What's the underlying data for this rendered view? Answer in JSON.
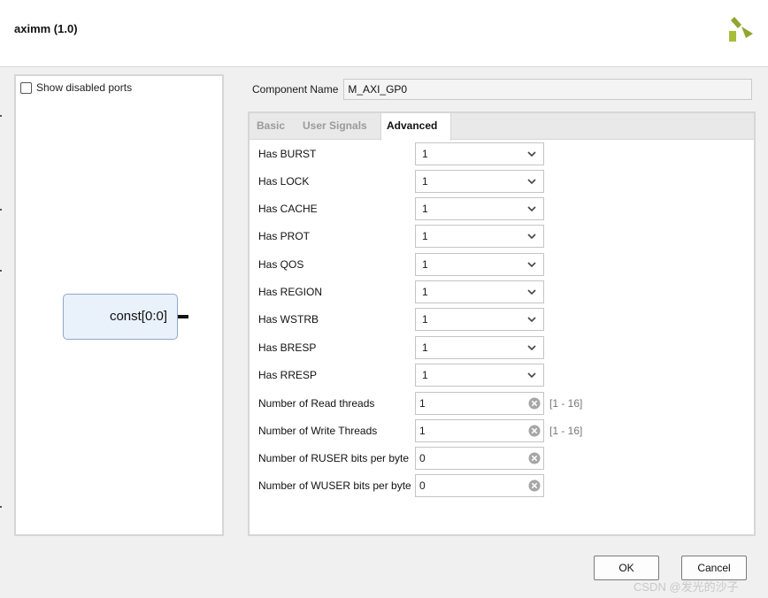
{
  "window": {
    "title": "aximm (1.0)"
  },
  "left_panel": {
    "show_disabled_ports_label": "Show disabled ports",
    "show_disabled_ports_checked": false,
    "block_port_label": "const[0:0]"
  },
  "component": {
    "label": "Component Name",
    "value": "M_AXI_GP0"
  },
  "tabs": [
    {
      "label": "Basic",
      "active": false
    },
    {
      "label": "User Signals",
      "active": false
    },
    {
      "label": "Advanced",
      "active": true
    }
  ],
  "params": {
    "has_burst": {
      "label": "Has BURST",
      "value": "1"
    },
    "has_lock": {
      "label": "Has LOCK",
      "value": "1"
    },
    "has_cache": {
      "label": "Has CACHE",
      "value": "1"
    },
    "has_prot": {
      "label": "Has PROT",
      "value": "1"
    },
    "has_qos": {
      "label": "Has QOS",
      "value": "1"
    },
    "has_region": {
      "label": "Has REGION",
      "value": "1"
    },
    "has_wstrb": {
      "label": "Has WSTRB",
      "value": "1"
    },
    "has_bresp": {
      "label": "Has BRESP",
      "value": "1"
    },
    "has_rresp": {
      "label": "Has RRESP",
      "value": "1"
    },
    "read_threads": {
      "label": "Number of Read threads",
      "value": "1",
      "range": "[1 - 16]"
    },
    "write_threads": {
      "label": "Number of Write Threads",
      "value": "1",
      "range": "[1 - 16]"
    },
    "ruser_bits": {
      "label": "Number of RUSER bits per byte",
      "value": "0"
    },
    "wuser_bits": {
      "label": "Number of WUSER bits per byte",
      "value": "0"
    }
  },
  "buttons": {
    "ok": "OK",
    "cancel": "Cancel"
  },
  "watermark": "CSDN @发光的沙子",
  "icons": {
    "logo": "xilinx-logo-icon",
    "dropdown": "chevron-down-icon",
    "clear": "clear-icon"
  },
  "colors": {
    "logo": "#8fa630",
    "block_fill": "#e9f1fb",
    "block_border": "#8fa9c9"
  }
}
